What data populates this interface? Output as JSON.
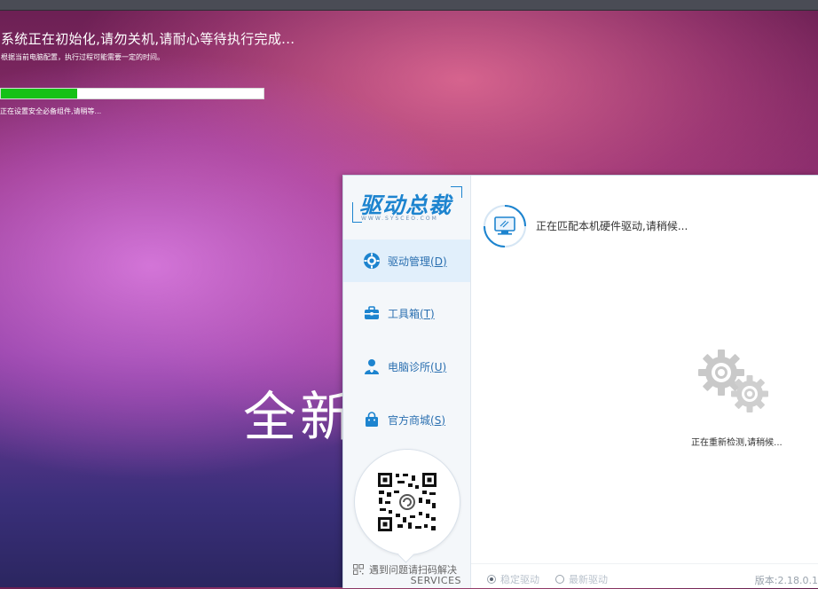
{
  "installer": {
    "title": "系统正在初始化,请勿关机,请耐心等待执行完成...",
    "subtitle": "根据当前电脑配置，执行过程可能需要一定的时间。",
    "progress_fraction": 0.29,
    "status": "正在设置安全必备组件,请稍等...",
    "background_text": "全新"
  },
  "app": {
    "logo": {
      "main": "驱动总裁",
      "sub": "WWW.SYSCEO.COM"
    },
    "nav": [
      {
        "label": "驱动管理",
        "hotkey": "(D)",
        "icon": "gear-icon",
        "active": true
      },
      {
        "label": "工具箱",
        "hotkey": "(T)",
        "icon": "toolbox-icon",
        "active": false
      },
      {
        "label": "电脑诊所",
        "hotkey": "(U)",
        "icon": "doctor-icon",
        "active": false
      },
      {
        "label": "官方商城",
        "hotkey": "(S)",
        "icon": "shopping-bag-icon",
        "active": false
      }
    ],
    "qr": {
      "help": "遇到问题请扫码解决",
      "services": "SERVICES"
    },
    "main": {
      "matching_text": "正在匹配本机硬件驱动,请稍候...",
      "recheck_text": "正在重新检测,请稍候..."
    },
    "footer": {
      "option_stable": "稳定驱动",
      "option_latest": "最新驱动",
      "selected": "stable",
      "version": "版本:2.18.0.1"
    },
    "colors": {
      "accent": "#1d84cf",
      "progress": "#16c116",
      "nav_active_bg": "#e1effb"
    }
  }
}
